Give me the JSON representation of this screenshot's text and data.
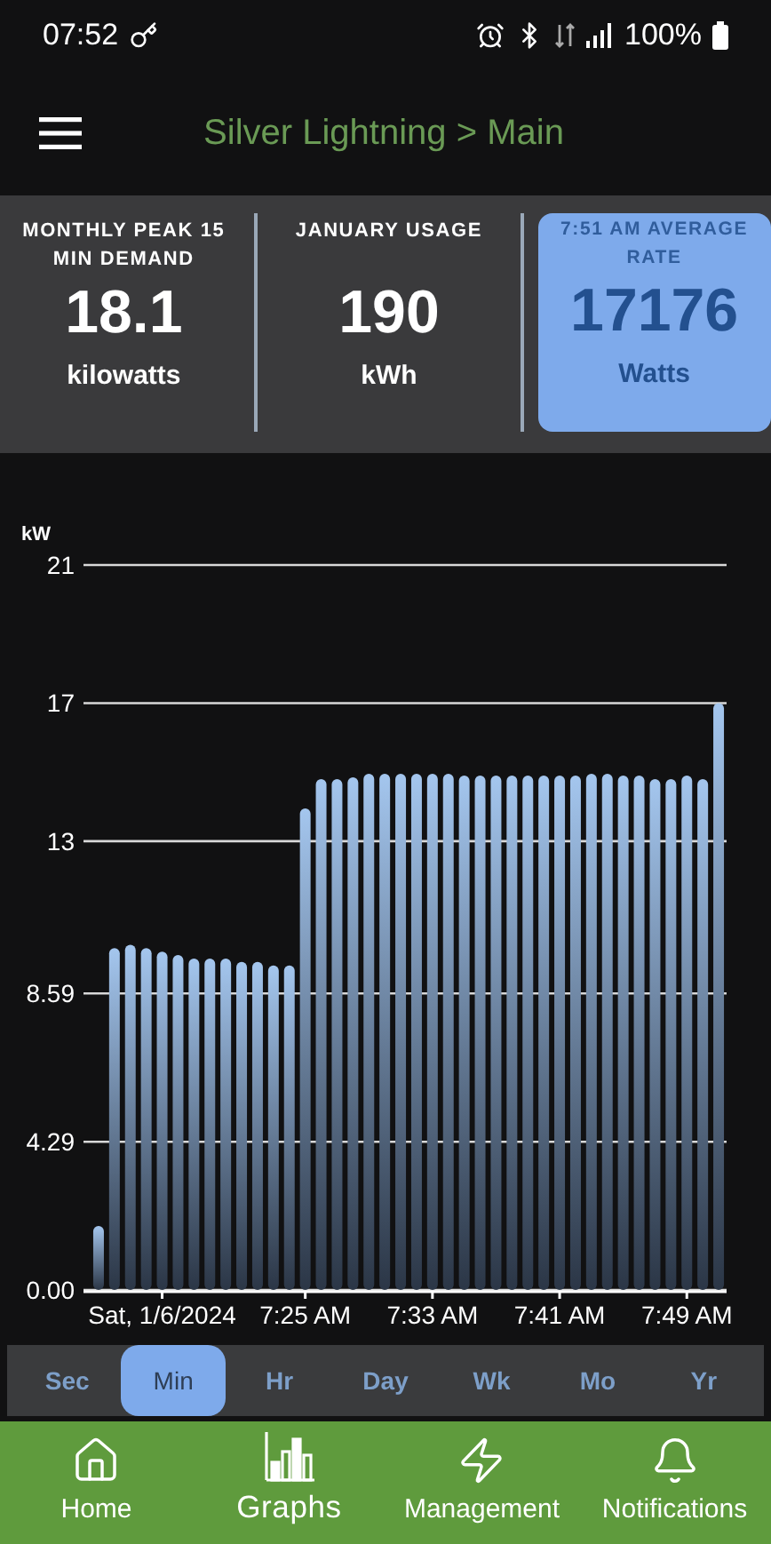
{
  "status_bar": {
    "time": "07:52",
    "battery": "100%"
  },
  "app_bar": {
    "title": "Silver Lightning > Main"
  },
  "stats": [
    {
      "label": "MONTHLY PEAK 15 MIN DEMAND",
      "value": "18.1",
      "unit": "kilowatts",
      "selected": false
    },
    {
      "label": "JANUARY USAGE",
      "value": "190",
      "unit": "kWh",
      "selected": false
    },
    {
      "label": "7:51 AM AVERAGE RATE",
      "value": "17176",
      "unit": "Watts",
      "selected": true
    }
  ],
  "chart": {
    "chart_data": {
      "type": "bar",
      "ylabel": "kW",
      "ylim": [
        0,
        21
      ],
      "yticks": [
        {
          "value": 0,
          "label": "0.00"
        },
        {
          "value": 4.29,
          "label": "4.29"
        },
        {
          "value": 8.59,
          "label": "8.59"
        },
        {
          "value": 13,
          "label": "13"
        },
        {
          "value": 17,
          "label": "17"
        },
        {
          "value": 21,
          "label": "21"
        }
      ],
      "grid": true,
      "categories": [
        null,
        null,
        null,
        null,
        "Sat, 1/6/2024",
        null,
        null,
        null,
        null,
        null,
        null,
        null,
        null,
        "7:25 AM",
        null,
        null,
        null,
        null,
        null,
        null,
        null,
        "7:33 AM",
        null,
        null,
        null,
        null,
        null,
        null,
        null,
        "7:41 AM",
        null,
        null,
        null,
        null,
        null,
        null,
        null,
        "7:49 AM",
        null,
        null
      ],
      "values": [
        1.85,
        9.9,
        10.0,
        9.9,
        9.8,
        9.7,
        9.6,
        9.6,
        9.6,
        9.5,
        9.5,
        9.4,
        9.4,
        13.95,
        14.8,
        14.8,
        14.85,
        14.95,
        14.95,
        14.95,
        14.95,
        14.95,
        14.95,
        14.9,
        14.9,
        14.9,
        14.9,
        14.9,
        14.9,
        14.9,
        14.9,
        14.95,
        14.95,
        14.9,
        14.9,
        14.8,
        14.8,
        14.9,
        14.8,
        17.0
      ]
    }
  },
  "ranges": [
    {
      "label": "Sec",
      "selected": false
    },
    {
      "label": "Min",
      "selected": true
    },
    {
      "label": "Hr",
      "selected": false
    },
    {
      "label": "Day",
      "selected": false
    },
    {
      "label": "Wk",
      "selected": false
    },
    {
      "label": "Mo",
      "selected": false
    },
    {
      "label": "Yr",
      "selected": false
    }
  ],
  "nav": [
    {
      "kind": "home",
      "label": "Home",
      "selected": false
    },
    {
      "kind": "graphs",
      "label": "Graphs",
      "selected": true
    },
    {
      "kind": "management",
      "label": "Management",
      "selected": false
    },
    {
      "kind": "notifications",
      "label": "Notifications",
      "selected": false
    }
  ]
}
